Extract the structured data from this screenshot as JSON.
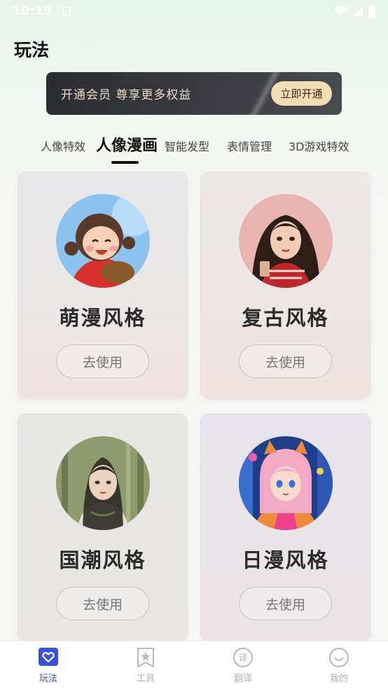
{
  "status_bar": {
    "time": "10:19"
  },
  "page": {
    "title": "玩法"
  },
  "vip_banner": {
    "text": "开通会员  尊享更多权益",
    "button": "立即开通"
  },
  "tabs": [
    {
      "label": "人像特效"
    },
    {
      "label": "人像漫画"
    },
    {
      "label": "智能发型"
    },
    {
      "label": "表情管理"
    },
    {
      "label": "3D游戏特效"
    }
  ],
  "active_tab_index": 1,
  "cards": [
    {
      "title": "萌漫风格",
      "button": "去使用"
    },
    {
      "title": "复古风格",
      "button": "去使用"
    },
    {
      "title": "国潮风格",
      "button": "去使用"
    },
    {
      "title": "日漫风格",
      "button": "去使用"
    }
  ],
  "bottom_nav": [
    {
      "label": "玩法",
      "icon": "heart-icon",
      "active": true
    },
    {
      "label": "工具",
      "icon": "star-bookmark-icon",
      "active": false
    },
    {
      "label": "翻译",
      "icon": "translate-icon",
      "active": false
    },
    {
      "label": "我的",
      "icon": "smile-icon",
      "active": false
    }
  ],
  "colors": {
    "accent": "#3b4fe0",
    "vip_gold": "#f1dcb4",
    "banner_dark": "#2b2c30"
  }
}
